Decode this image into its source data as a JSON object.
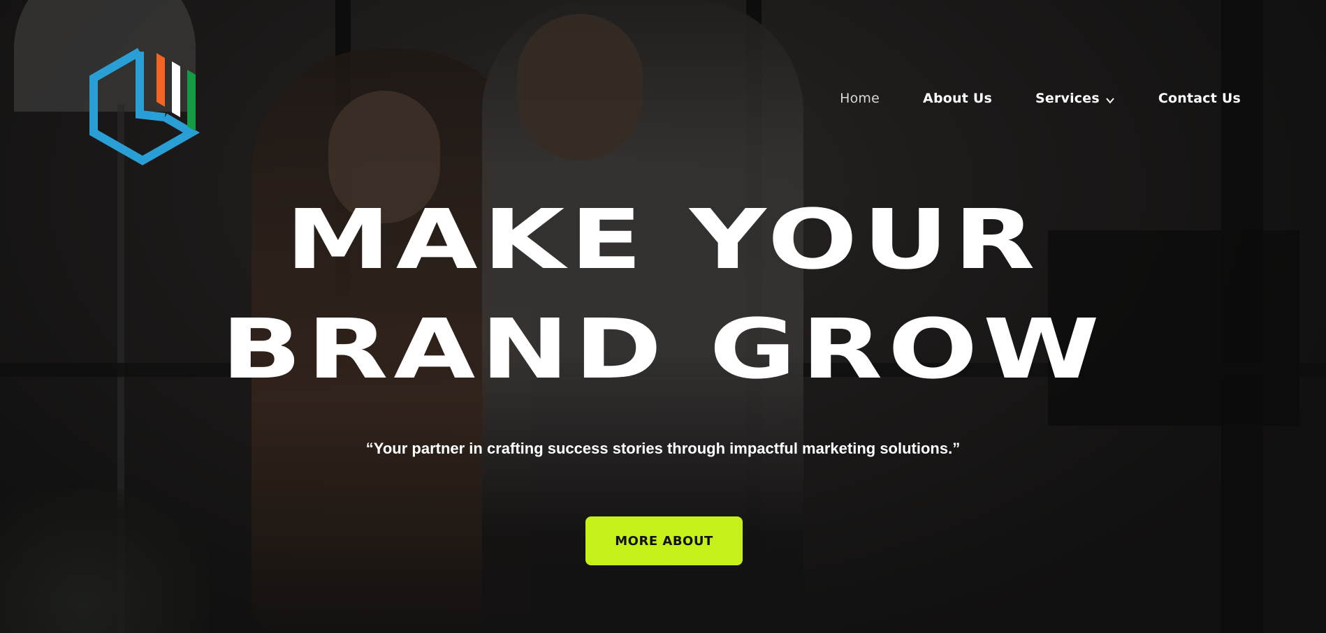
{
  "brand": {
    "logo_icon": "hexagon-bars-logo-icon",
    "colors": {
      "logo_blue": "#2a9fd6",
      "logo_orange": "#f26522",
      "logo_white": "#ffffff",
      "logo_green": "#139a43",
      "accent": "#c5f01a"
    }
  },
  "nav": {
    "items": [
      {
        "label": "Home",
        "active": true
      },
      {
        "label": "About Us",
        "active": false
      },
      {
        "label": "Services",
        "active": false,
        "icon": "chevron-down-icon"
      },
      {
        "label": "Contact Us",
        "active": false
      }
    ]
  },
  "hero": {
    "headline_line1": "MAKE YOUR",
    "headline_line2": "BRAND GROW",
    "subtitle": "“Your partner in crafting success stories through impactful marketing solutions.”",
    "cta_label": "MORE ABOUT"
  }
}
